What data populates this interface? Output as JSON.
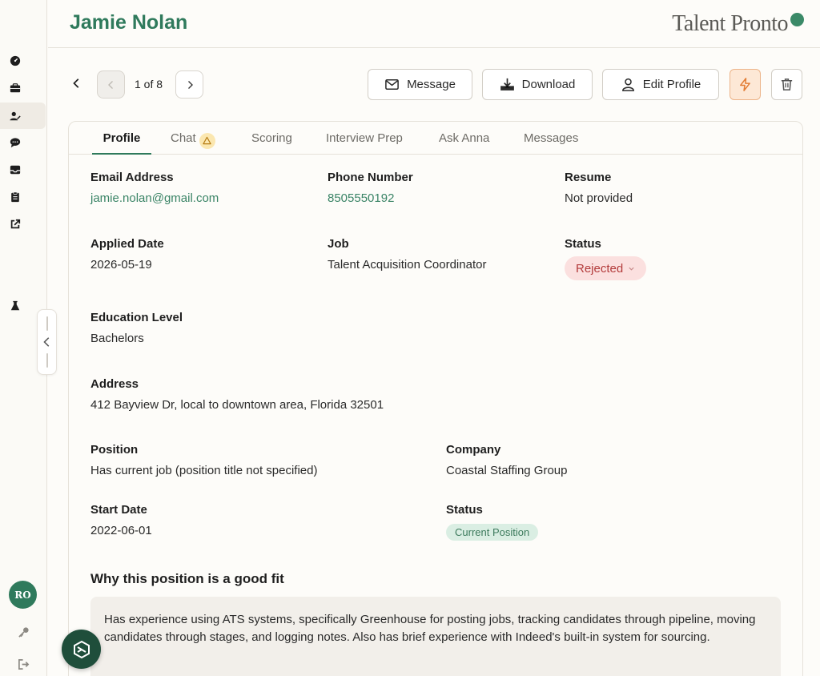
{
  "header": {
    "title": "Jamie Nolan",
    "logo": "Talent Pronto"
  },
  "sidebar": {
    "icons": [
      "dashboard-icon",
      "briefcase-icon",
      "candidates-icon",
      "chat-icon",
      "inbox-icon",
      "clipboard-icon",
      "external-link-icon",
      "flask-icon"
    ],
    "active": "candidates-icon",
    "avatar_initials": "RO",
    "bottom_icons": [
      "key-icon",
      "logout-icon"
    ]
  },
  "toolbar": {
    "pager": "1 of 8",
    "message_label": "Message",
    "download_label": "Download",
    "edit_label": "Edit Profile"
  },
  "tabs": [
    {
      "label": "Profile",
      "active": true
    },
    {
      "label": "Chat",
      "badge": "warning-icon"
    },
    {
      "label": "Scoring"
    },
    {
      "label": "Interview Prep"
    },
    {
      "label": "Ask Anna"
    },
    {
      "label": "Messages"
    }
  ],
  "profile": {
    "email_label": "Email Address",
    "email": "jamie.nolan@gmail.com",
    "phone_label": "Phone Number",
    "phone": "8505550192",
    "resume_label": "Resume",
    "resume": "Not provided",
    "applied_label": "Applied Date",
    "applied": "2026-05-19",
    "job_label": "Job",
    "job": "Talent Acquisition Coordinator",
    "status_label": "Status",
    "status": "Rejected",
    "education_label": "Education Level",
    "education": "Bachelors",
    "address_label": "Address",
    "address": "412 Bayview Dr, local to downtown area, Florida 32501"
  },
  "employment": {
    "position_label": "Position",
    "position": "Has current job (position title not specified)",
    "company_label": "Company",
    "company": "Coastal Staffing Group",
    "start_label": "Start Date",
    "start": "2022-06-01",
    "status_label": "Status",
    "status": "Current Position"
  },
  "fit": {
    "title": "Why this position is a good fit",
    "text": "Has experience using ATS systems, specifically Greenhouse for posting jobs, tracking candidates through pipeline, moving candidates through stages, and logging notes. Also has brief experience with Indeed's built-in system for sourcing."
  },
  "colors": {
    "brand": "#2f7a5c",
    "rejected_bg": "#fbe0df",
    "rejected_text": "#b33b3b",
    "current_bg": "#daeee3",
    "accent_orange": "#e37d34"
  }
}
